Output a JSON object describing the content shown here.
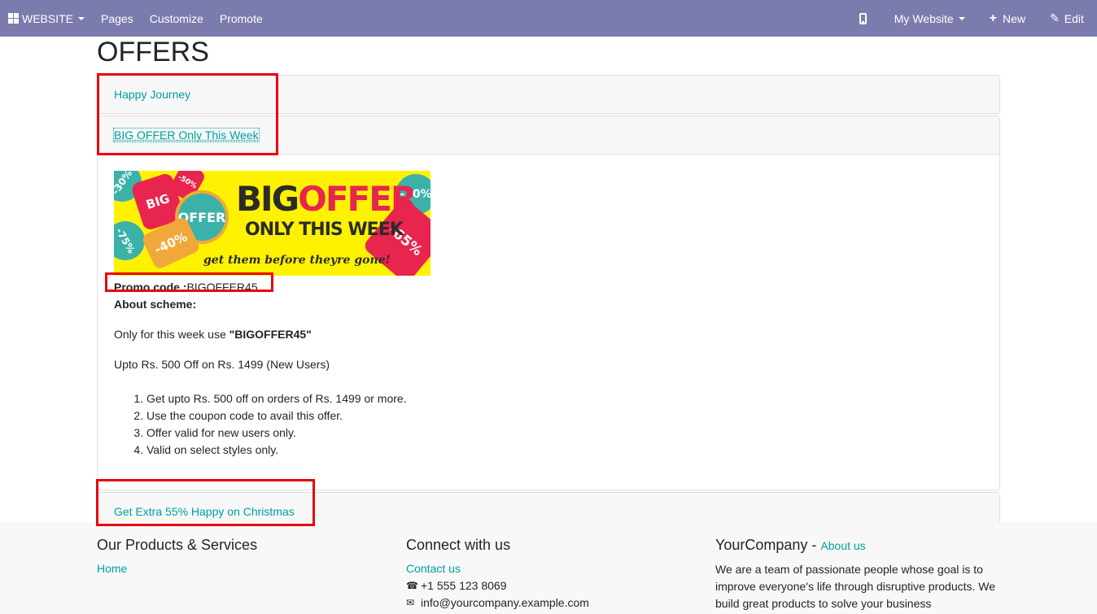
{
  "navbar": {
    "apps_label": "WEBSITE",
    "items": [
      "Pages",
      "Customize",
      "Promote"
    ],
    "website_selector": "My Website",
    "new_label": "New",
    "edit_label": "Edit"
  },
  "page": {
    "title": "OFFERS"
  },
  "accordion": [
    {
      "label": "Happy Journey"
    },
    {
      "label": "BIG OFFER Only This Week"
    },
    {
      "label": "Get Extra 55% Happy on Christmas"
    }
  ],
  "offer": {
    "banner": {
      "big": "BIG",
      "offer": "OFFER",
      "subtitle": "ONLY THIS WEEK",
      "tagline": "get them before theyre gone!",
      "tags": [
        "-30%",
        "BIG",
        "-50%",
        "OFFER",
        "-75%",
        "-40%",
        "-30%",
        "-65%"
      ]
    },
    "promo_label": "Promo code :",
    "promo_code": "BIGOFFER45",
    "about_label": "About scheme:",
    "week_text": "Only for this week use ",
    "week_code": "\"BIGOFFER45\"",
    "upto_text": "Upto Rs. 500 Off on Rs. 1499 (New Users)",
    "steps": [
      "Get upto Rs. 500 off on orders of Rs. 1499 or more.",
      "Use the coupon code to avail this offer.",
      "Offer valid for new users only.",
      "Valid on select styles only."
    ]
  },
  "footer": {
    "products_title": "Our Products & Services",
    "home_link": "Home",
    "connect_title": "Connect with us",
    "contact_link": "Contact us",
    "phone": "+1 555 123 8069",
    "email": "info@yourcompany.example.com",
    "company_title": "YourCompany",
    "about_link": "About us",
    "about_text": "We are a team of passionate people whose goal is to improve everyone's life through disruptive products. We build great products to solve your business"
  },
  "colors": {
    "navbar": "#7c7bad",
    "link": "#00a09d",
    "highlight": "#e8000b",
    "banner_yellow": "#fff200"
  }
}
